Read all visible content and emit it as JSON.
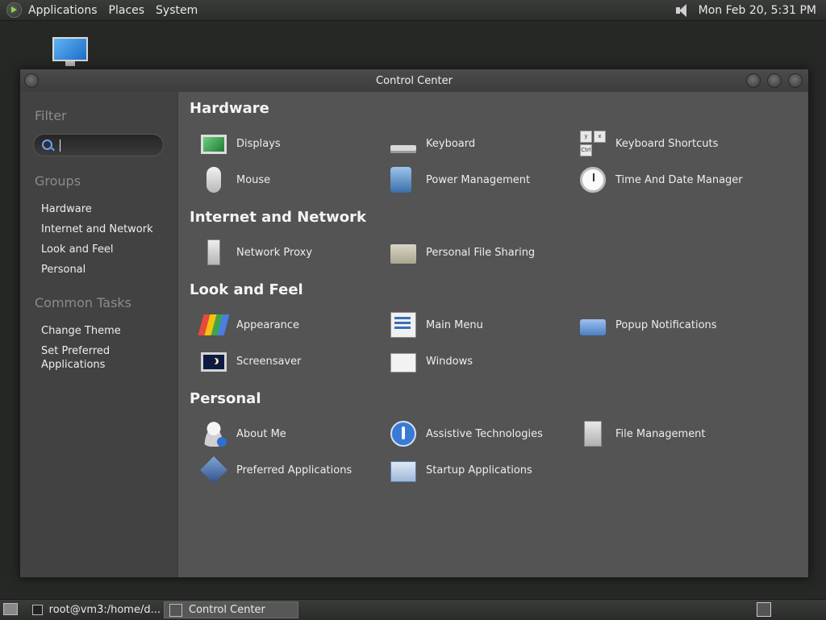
{
  "top_panel": {
    "menus": [
      "Applications",
      "Places",
      "System"
    ],
    "clock": "Mon Feb 20,  5:31 PM"
  },
  "window": {
    "title": "Control Center"
  },
  "sidebar": {
    "filter_heading": "Filter",
    "search_value": "",
    "groups_heading": "Groups",
    "groups": [
      "Hardware",
      "Internet and Network",
      "Look and Feel",
      "Personal"
    ],
    "common_tasks_heading": "Common Tasks",
    "tasks": [
      "Change Theme",
      "Set Preferred Applications"
    ]
  },
  "content": {
    "groups": [
      {
        "title": "Hardware",
        "items": [
          {
            "label": "Displays",
            "icon": "displays-icon"
          },
          {
            "label": "Keyboard",
            "icon": "keyboard-icon"
          },
          {
            "label": "Keyboard Shortcuts",
            "icon": "keyboard-shortcuts-icon"
          },
          {
            "label": "Mouse",
            "icon": "mouse-icon"
          },
          {
            "label": "Power Management",
            "icon": "power-management-icon"
          },
          {
            "label": "Time And Date Manager",
            "icon": "clock-icon"
          }
        ]
      },
      {
        "title": "Internet and Network",
        "items": [
          {
            "label": "Network Proxy",
            "icon": "network-proxy-icon"
          },
          {
            "label": "Personal File Sharing",
            "icon": "folder-share-icon"
          }
        ]
      },
      {
        "title": "Look and Feel",
        "items": [
          {
            "label": "Appearance",
            "icon": "appearance-icon"
          },
          {
            "label": "Main Menu",
            "icon": "main-menu-icon"
          },
          {
            "label": "Popup Notifications",
            "icon": "popup-notifications-icon"
          },
          {
            "label": "Screensaver",
            "icon": "screensaver-icon"
          },
          {
            "label": "Windows",
            "icon": "windows-icon"
          }
        ]
      },
      {
        "title": "Personal",
        "items": [
          {
            "label": "About Me",
            "icon": "about-me-icon"
          },
          {
            "label": "Assistive Technologies",
            "icon": "assistive-technologies-icon"
          },
          {
            "label": "File Management",
            "icon": "file-management-icon"
          },
          {
            "label": "Preferred Applications",
            "icon": "preferred-applications-icon"
          },
          {
            "label": "Startup Applications",
            "icon": "startup-applications-icon"
          }
        ]
      }
    ],
    "shortcut_keys": [
      "y",
      "x",
      "Ctrl"
    ]
  },
  "bottom_panel": {
    "tasks": [
      "root@vm3:/home/d...",
      "Control Center"
    ]
  }
}
